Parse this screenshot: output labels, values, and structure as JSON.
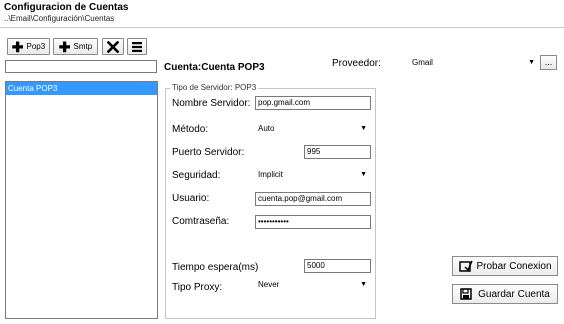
{
  "header": {
    "title": "Configuracion de Cuentas",
    "path": "..\\Email\\Configuración\\Cuentas"
  },
  "toolbar": {
    "add_pop3_label": "Pop3",
    "add_smtp_label": "Smtp"
  },
  "search": {
    "value": ""
  },
  "accounts": {
    "items": [
      {
        "label": "Cuenta POP3",
        "selected": true
      }
    ]
  },
  "detail": {
    "account_name": "Cuenta:Cuenta POP3",
    "provider_label": "Proveedor:",
    "provider_value": "Gmail",
    "provider_more_label": "..."
  },
  "server_group": {
    "legend": "Tipo de Servidor: POP3",
    "fields": {
      "server_name": {
        "label": "Nombre Servidor:",
        "value": "pop.gmail.com"
      },
      "method": {
        "label": "Método:",
        "value": "Auto"
      },
      "port": {
        "label": "Puerto Servidor:",
        "value": "995"
      },
      "security": {
        "label": "Seguridad:",
        "value": "Implicit"
      },
      "user": {
        "label": "Usuario:",
        "value": "cuenta.pop@gmail.com"
      },
      "password": {
        "label": "Comtraseña:",
        "value": "•••••••••••"
      },
      "timeout": {
        "label": "Tiempo espera(ms)",
        "value": "5000"
      },
      "proxy": {
        "label": "Tipo Proxy:",
        "value": "Never"
      }
    }
  },
  "actions": {
    "test_label": "Probar Conexion",
    "save_label": "Guardar Cuenta"
  }
}
